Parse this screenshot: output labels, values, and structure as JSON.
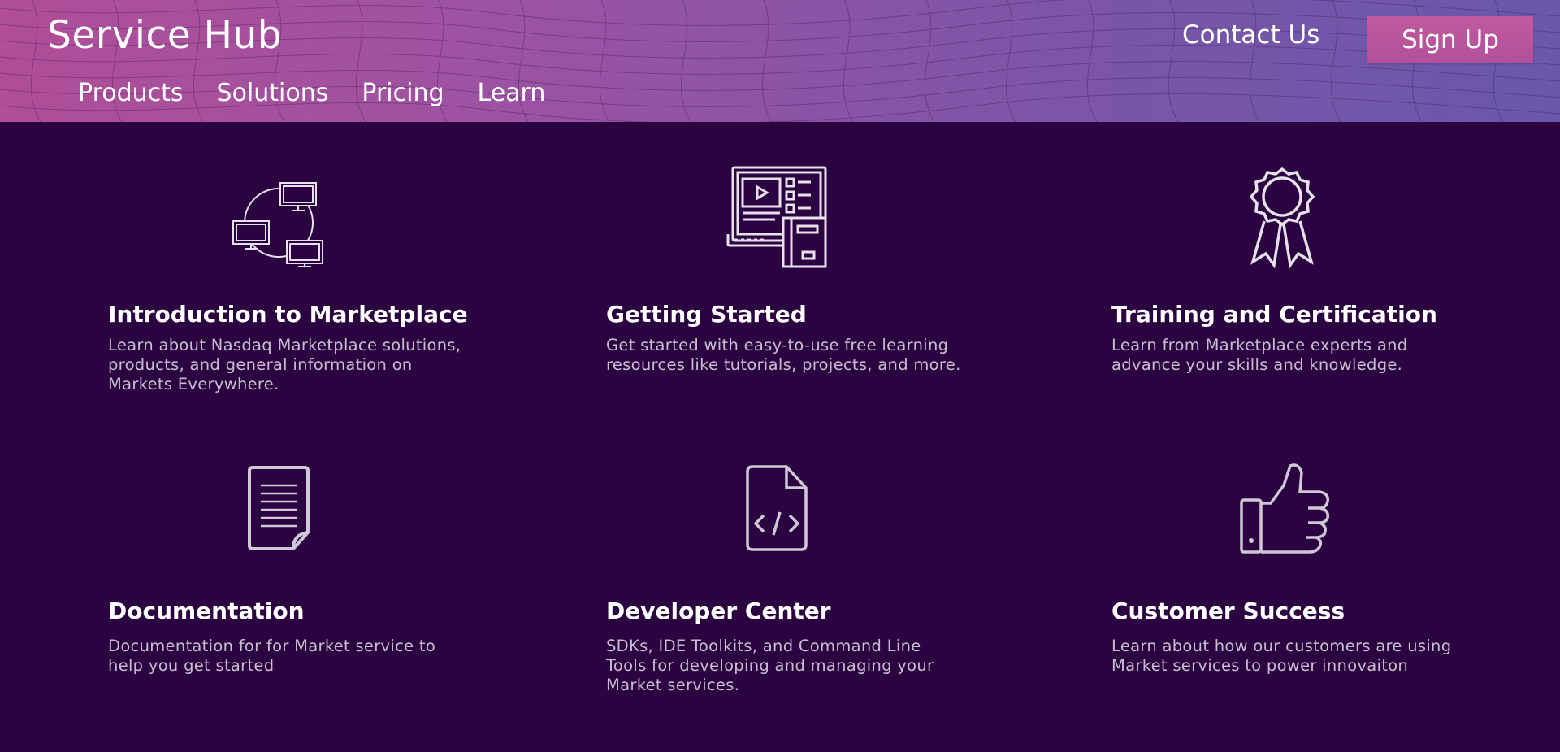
{
  "header": {
    "brand": "Service Hub",
    "nav": [
      "Products",
      "Solutions",
      "Pricing",
      "Learn"
    ],
    "contact": "Contact Us",
    "signup": "Sign Up"
  },
  "cards": [
    {
      "icon": "networked-computers-icon",
      "title": "Introduction to Marketplace",
      "desc": "Learn about Nasdaq Marketplace solutions, products, and general information on Markets Everywhere."
    },
    {
      "icon": "video-tutorial-icon",
      "title": "Getting Started",
      "desc": "Get started with easy-to-use free learning resources like tutorials, projects, and more."
    },
    {
      "icon": "award-ribbon-icon",
      "title": "Training and Certification",
      "desc": "Learn from Marketplace experts and advance your skills and knowledge."
    },
    {
      "icon": "document-icon",
      "title": "Documentation",
      "desc": "Documentation for for Market service to help you get started"
    },
    {
      "icon": "code-file-icon",
      "title": "Developer Center",
      "desc": "SDKs, IDE Toolkits, and Command Line Tools for developing and managing your Market services."
    },
    {
      "icon": "thumbs-up-icon",
      "title": "Customer Success",
      "desc": "Learn about how our customers are using Market services to power innovaiton"
    }
  ],
  "colors": {
    "background": "#2a0340",
    "header_start": "#b04e98",
    "header_end": "#6a58aa",
    "signup": "#c15a9e",
    "icon_stroke": "#e6e1ea"
  }
}
